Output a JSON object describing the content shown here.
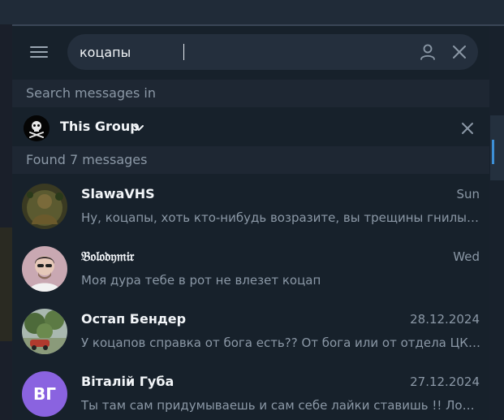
{
  "search": {
    "query": "коцапы"
  },
  "sections": {
    "scope_header": "Search messages in",
    "results_header": "Found 7 messages"
  },
  "scope": {
    "label": "This Group"
  },
  "results": [
    {
      "name": "SlawaVHS",
      "date": "Sun",
      "message": "Ну, коцапы, хоть кто-нибудь возразите, вы трещины гнилые собрались тут"
    },
    {
      "name": "𝔅𝔬𝔩𝔬𝔡𝔶𝔪𝔦𝔯",
      "date": "Wed",
      "message": "Моя дура тебе в рот не влезет коцап"
    },
    {
      "name": "Остап Бендер",
      "date": "28.12.2024",
      "message": "У коцапов справка от бога есть?? От бога или от отдела ЦКГБ у коцапов"
    },
    {
      "name": "Віталій Губа",
      "date": "27.12.2024",
      "initials": "ВГ",
      "message": "Ты там сам придумываешь и сам себе лайки ставишь !! Лошара коцап"
    }
  ],
  "colors": {
    "panel_bg": "#17212b",
    "section_bg": "#1e2733",
    "search_box": "#242f3d",
    "muted_text": "#8b98a6",
    "avatar_purple": "#8a63e0"
  },
  "icons": [
    "menu-icon",
    "user-icon",
    "close-icon",
    "chevron-down-icon"
  ]
}
